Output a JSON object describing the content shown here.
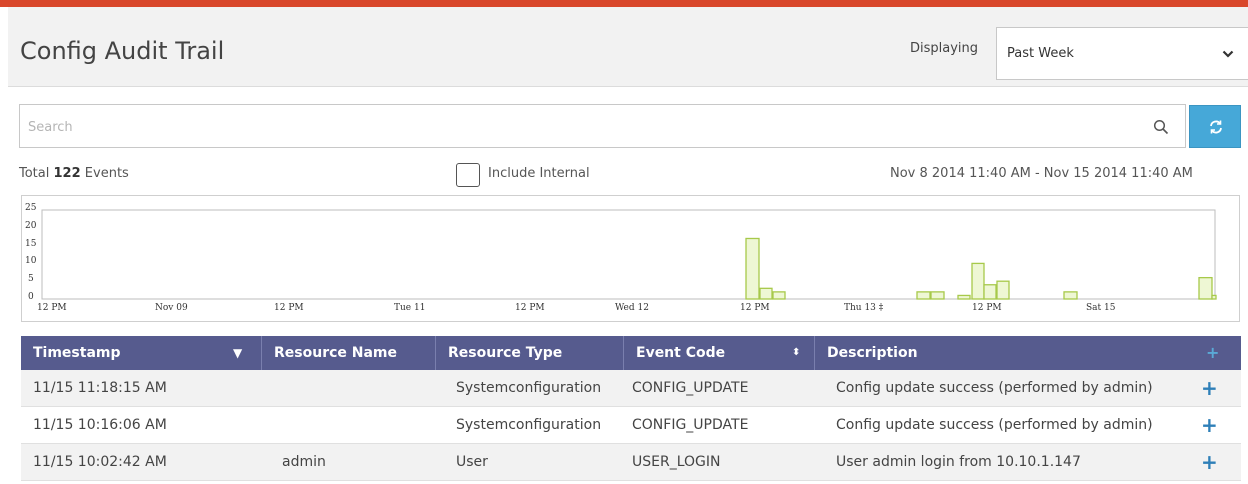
{
  "header": {
    "title": "Config Audit Trail",
    "displaying_label": "Displaying",
    "range_value": "Past Week"
  },
  "search": {
    "placeholder": "Search"
  },
  "summary": {
    "total_prefix": "Total",
    "total_count": "122",
    "total_suffix": "Events",
    "include_internal_label": "Include Internal",
    "date_range": "Nov 8 2014 11:40 AM - Nov 15 2014 11:40 AM"
  },
  "chart_data": {
    "type": "bar",
    "y_ticks": [
      "25",
      "20",
      "15",
      "10",
      "5",
      "0"
    ],
    "ylim": [
      0,
      25
    ],
    "x_tick_labels": [
      "12 PM",
      "Nov 09",
      "12 PM",
      "Tue 11",
      "12 PM",
      "Wed 12",
      "12 PM",
      "Thu 13 ‡",
      "12 PM",
      "Sat 15"
    ],
    "bars": [
      {
        "slot": 0,
        "value": 17
      },
      {
        "slot": 1,
        "value": 3
      },
      {
        "slot": 2,
        "value": 2
      },
      {
        "slot": 3,
        "value": 2
      },
      {
        "slot": 4,
        "value": 2
      },
      {
        "slot": 5,
        "value": 1
      },
      {
        "slot": 6,
        "value": 10
      },
      {
        "slot": 7,
        "value": 4
      },
      {
        "slot": 8,
        "value": 5
      },
      {
        "slot": 9,
        "value": 2
      },
      {
        "slot": 10,
        "value": 6
      },
      {
        "slot": 11,
        "value": 1
      }
    ],
    "bar_fill": "#eef7d4",
    "bar_stroke": "#a7c94a",
    "grid": false
  },
  "table": {
    "columns": [
      "Timestamp",
      "Resource Name",
      "Resource Type",
      "Event Code",
      "Description"
    ],
    "rows": [
      {
        "timestamp": "11/15 11:18:15 AM",
        "resource_name": "",
        "resource_type": "Systemconfiguration",
        "event_code": "CONFIG_UPDATE",
        "description": "Config update success (performed by admin)"
      },
      {
        "timestamp": "11/15 10:16:06 AM",
        "resource_name": "",
        "resource_type": "Systemconfiguration",
        "event_code": "CONFIG_UPDATE",
        "description": "Config update success (performed by admin)"
      },
      {
        "timestamp": "11/15 10:02:42 AM",
        "resource_name": "admin",
        "resource_type": "User",
        "event_code": "USER_LOGIN",
        "description": "User admin login from 10.10.1.147"
      }
    ]
  },
  "colors": {
    "accent_bar": "#d9472b",
    "table_header": "#565b8e",
    "refresh_button": "#46a8d8",
    "plus_icon": "#2e7fb8"
  },
  "icons": [
    "chevron-down-icon",
    "search-icon",
    "refresh-icon",
    "plus-icon",
    "sort-desc-icon",
    "sort-updown-icon"
  ]
}
